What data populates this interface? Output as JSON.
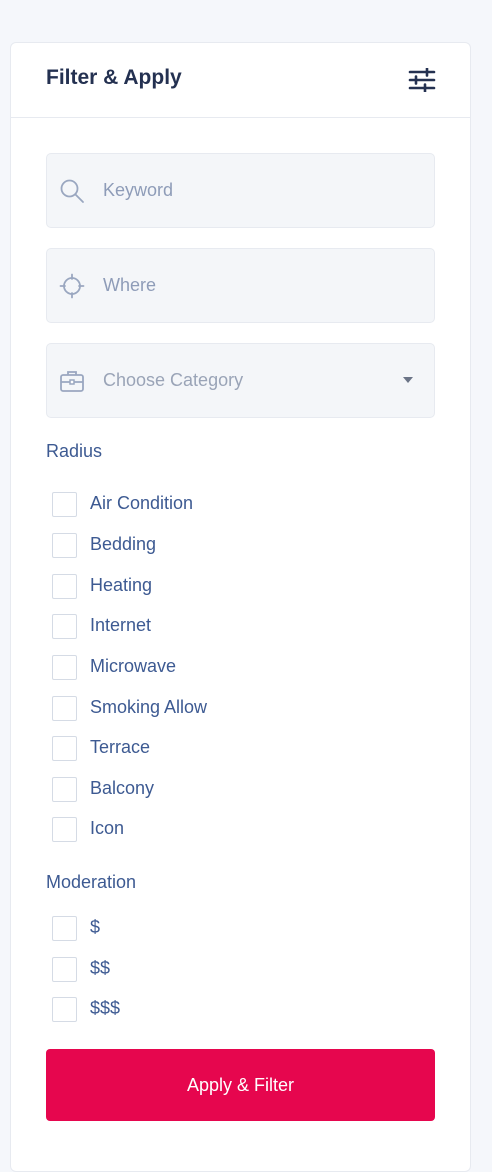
{
  "panel": {
    "title": "Filter & Apply",
    "header_icon": "sliders-icon"
  },
  "fields": {
    "keyword": {
      "placeholder": "Keyword",
      "icon": "search-icon"
    },
    "where": {
      "placeholder": "Where",
      "icon": "crosshair-icon"
    },
    "category": {
      "selected": "Choose Category",
      "icon": "briefcase-icon"
    }
  },
  "radius": {
    "label": "Radius",
    "options": [
      "Air Condition",
      "Bedding",
      "Heating",
      "Internet",
      "Microwave",
      "Smoking Allow",
      "Terrace",
      "Balcony",
      "Icon"
    ]
  },
  "moderation": {
    "label": "Moderation",
    "options": [
      "$",
      "$$",
      "$$$"
    ]
  },
  "apply_button": {
    "label": "Apply & Filter"
  },
  "colors": {
    "accent": "#e6064e",
    "heading": "#243151",
    "label": "#3d5a92",
    "field_bg": "#f4f6f9",
    "icon": "#8e9cb8"
  }
}
